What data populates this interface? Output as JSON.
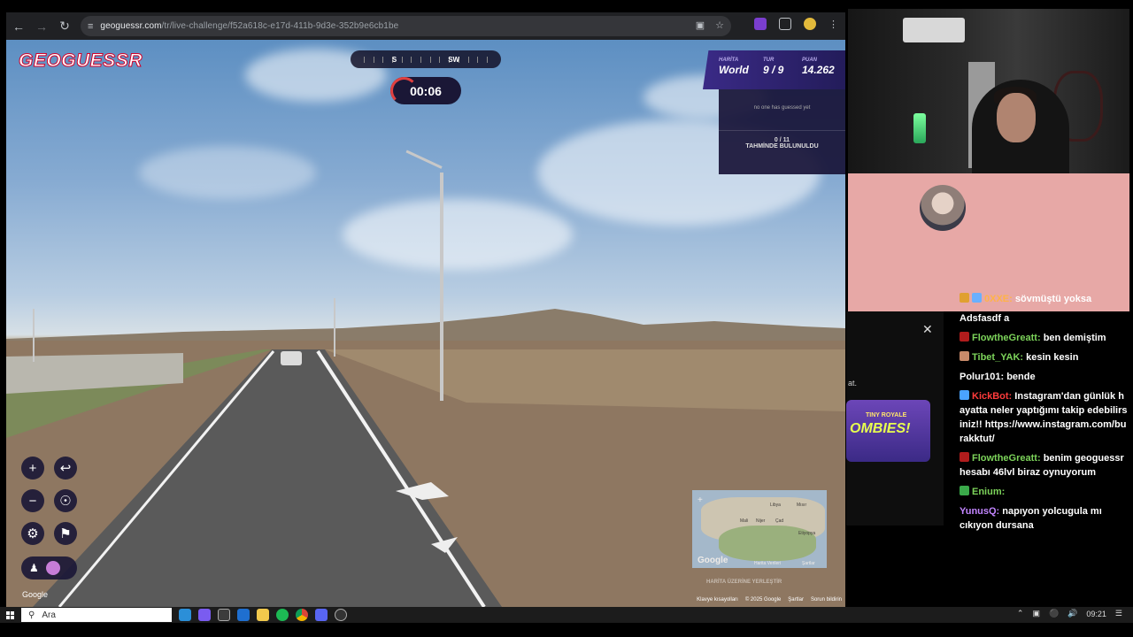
{
  "browser": {
    "url_host": "geoguessr.com",
    "url_path": "/tr/live-challenge/f52a618c-e17d-411b-9d3e-352b9e6cb1be"
  },
  "game": {
    "logo": "GEOGUESSR",
    "compass": {
      "left": "S",
      "right": "SW"
    },
    "timer": "00:06",
    "hud": {
      "map_label": "HARİTA",
      "map_value": "World",
      "round_label": "TUR",
      "round_value": "9 / 9",
      "score_label": "PUAN",
      "score_value": "14.262"
    },
    "guess_panel": {
      "empty_text": "no one has guessed yet",
      "count": "0 / 11",
      "count_label": "TAHMİNDE BULUNULDU"
    },
    "place_guess": "HARİTA ÜZERİNE YERLEŞTİR",
    "google": "Google",
    "minimap_google": "Google",
    "minimap_plus": "+",
    "minimap_labels": [
      "Libya",
      "Mali",
      "Nijer",
      "Çad",
      "Mısır",
      "Etiyopya"
    ],
    "minimap_footer": [
      "Harita Verileri",
      "Şartlar"
    ],
    "attribution": [
      "Klavye kısayolları",
      "© 2025 Google",
      "Şartlar",
      "Sorun bildirin"
    ]
  },
  "chat": {
    "first": {
      "user": "0XXE:",
      "text": "sövmüştü yoksa"
    },
    "messages": [
      {
        "user": "",
        "text": "Adsfasdf a",
        "user_color": "#ffffff",
        "badge": ""
      },
      {
        "user": "FlowtheGreatt:",
        "text": "ben demiştim",
        "user_color": "#7cd35a",
        "badge": "#b01c1c"
      },
      {
        "user": "Tibet_YAK:",
        "text": "kesin kesin",
        "user_color": "#7cd35a",
        "badge": "#c88a6a"
      },
      {
        "user": "Polur101:",
        "text": "bende",
        "user_color": "#ffffff",
        "badge": ""
      },
      {
        "user": "KickBot:",
        "text": "Instagram'dan günlük hayatta neler yaptığımı takip edebilirsiniz!! https://www.instagram.com/burakktut/",
        "user_color": "#ff3b3b",
        "badge": "#4aa3ff"
      },
      {
        "user": "FlowtheGreatt:",
        "text": "benim geoguessr hesabı 46lvl biraz oynuyorum",
        "user_color": "#7cd35a",
        "badge": "#b01c1c"
      },
      {
        "user": "Enium:",
        "text": "",
        "user_color": "#7cd35a",
        "badge": "#3aa94a"
      },
      {
        "user": "YunusQ:",
        "text": "napıyon yolcugula mı cıkıyon dursana",
        "user_color": "#c285ff",
        "badge": ""
      }
    ],
    "side_text": "at.",
    "ad_line1": "TINY ROYALE",
    "ad_line2": "OMBIES!"
  },
  "taskbar": {
    "search_placeholder": "Ara",
    "time": "09:21"
  }
}
